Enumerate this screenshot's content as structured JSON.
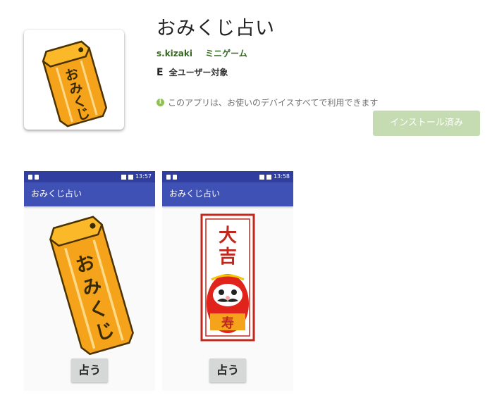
{
  "app": {
    "title": "おみくじ占い",
    "developer": "s.kizaki",
    "category": "ミニゲーム",
    "content_rating_badge": "E",
    "content_rating": "全ユーザー対象",
    "compatibility": "このアプリは、お使いのデバイスすべてで利用できます",
    "install_label": "インストール済み"
  },
  "icon_art": {
    "cylinder_text": [
      "お",
      "み",
      "く",
      "じ"
    ]
  },
  "screenshots": [
    {
      "time": "13:57",
      "appbar_title": "おみくじ占い",
      "button_label": "占う",
      "art_text": [
        "お",
        "み",
        "く",
        "じ"
      ]
    },
    {
      "time": "13:58",
      "appbar_title": "おみくじ占い",
      "button_label": "占う",
      "fortune": [
        "大",
        "吉"
      ],
      "daruma_text": "寿"
    }
  ],
  "colors": {
    "accent": "#33691e",
    "install_bg": "#c5dcb2",
    "statusbar": "#303f9f",
    "appbar": "#3f51b5",
    "cylinder": "#f5a623"
  }
}
